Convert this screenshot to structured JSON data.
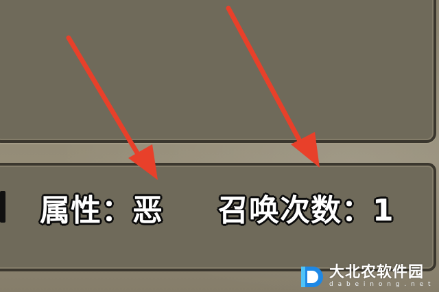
{
  "info_bar": {
    "attribute": "属性：恶",
    "summon_count": "召唤次数：1"
  },
  "watermark": {
    "name": "大北农软件园",
    "domain": "d a b e i n o n g . n e t"
  },
  "colors": {
    "panel": "#6f6a5a",
    "panel_border": "#3b372e",
    "arrow": "#e8402a"
  },
  "icons": [
    "red-arrow-icon",
    "watermark-logo-icon"
  ]
}
